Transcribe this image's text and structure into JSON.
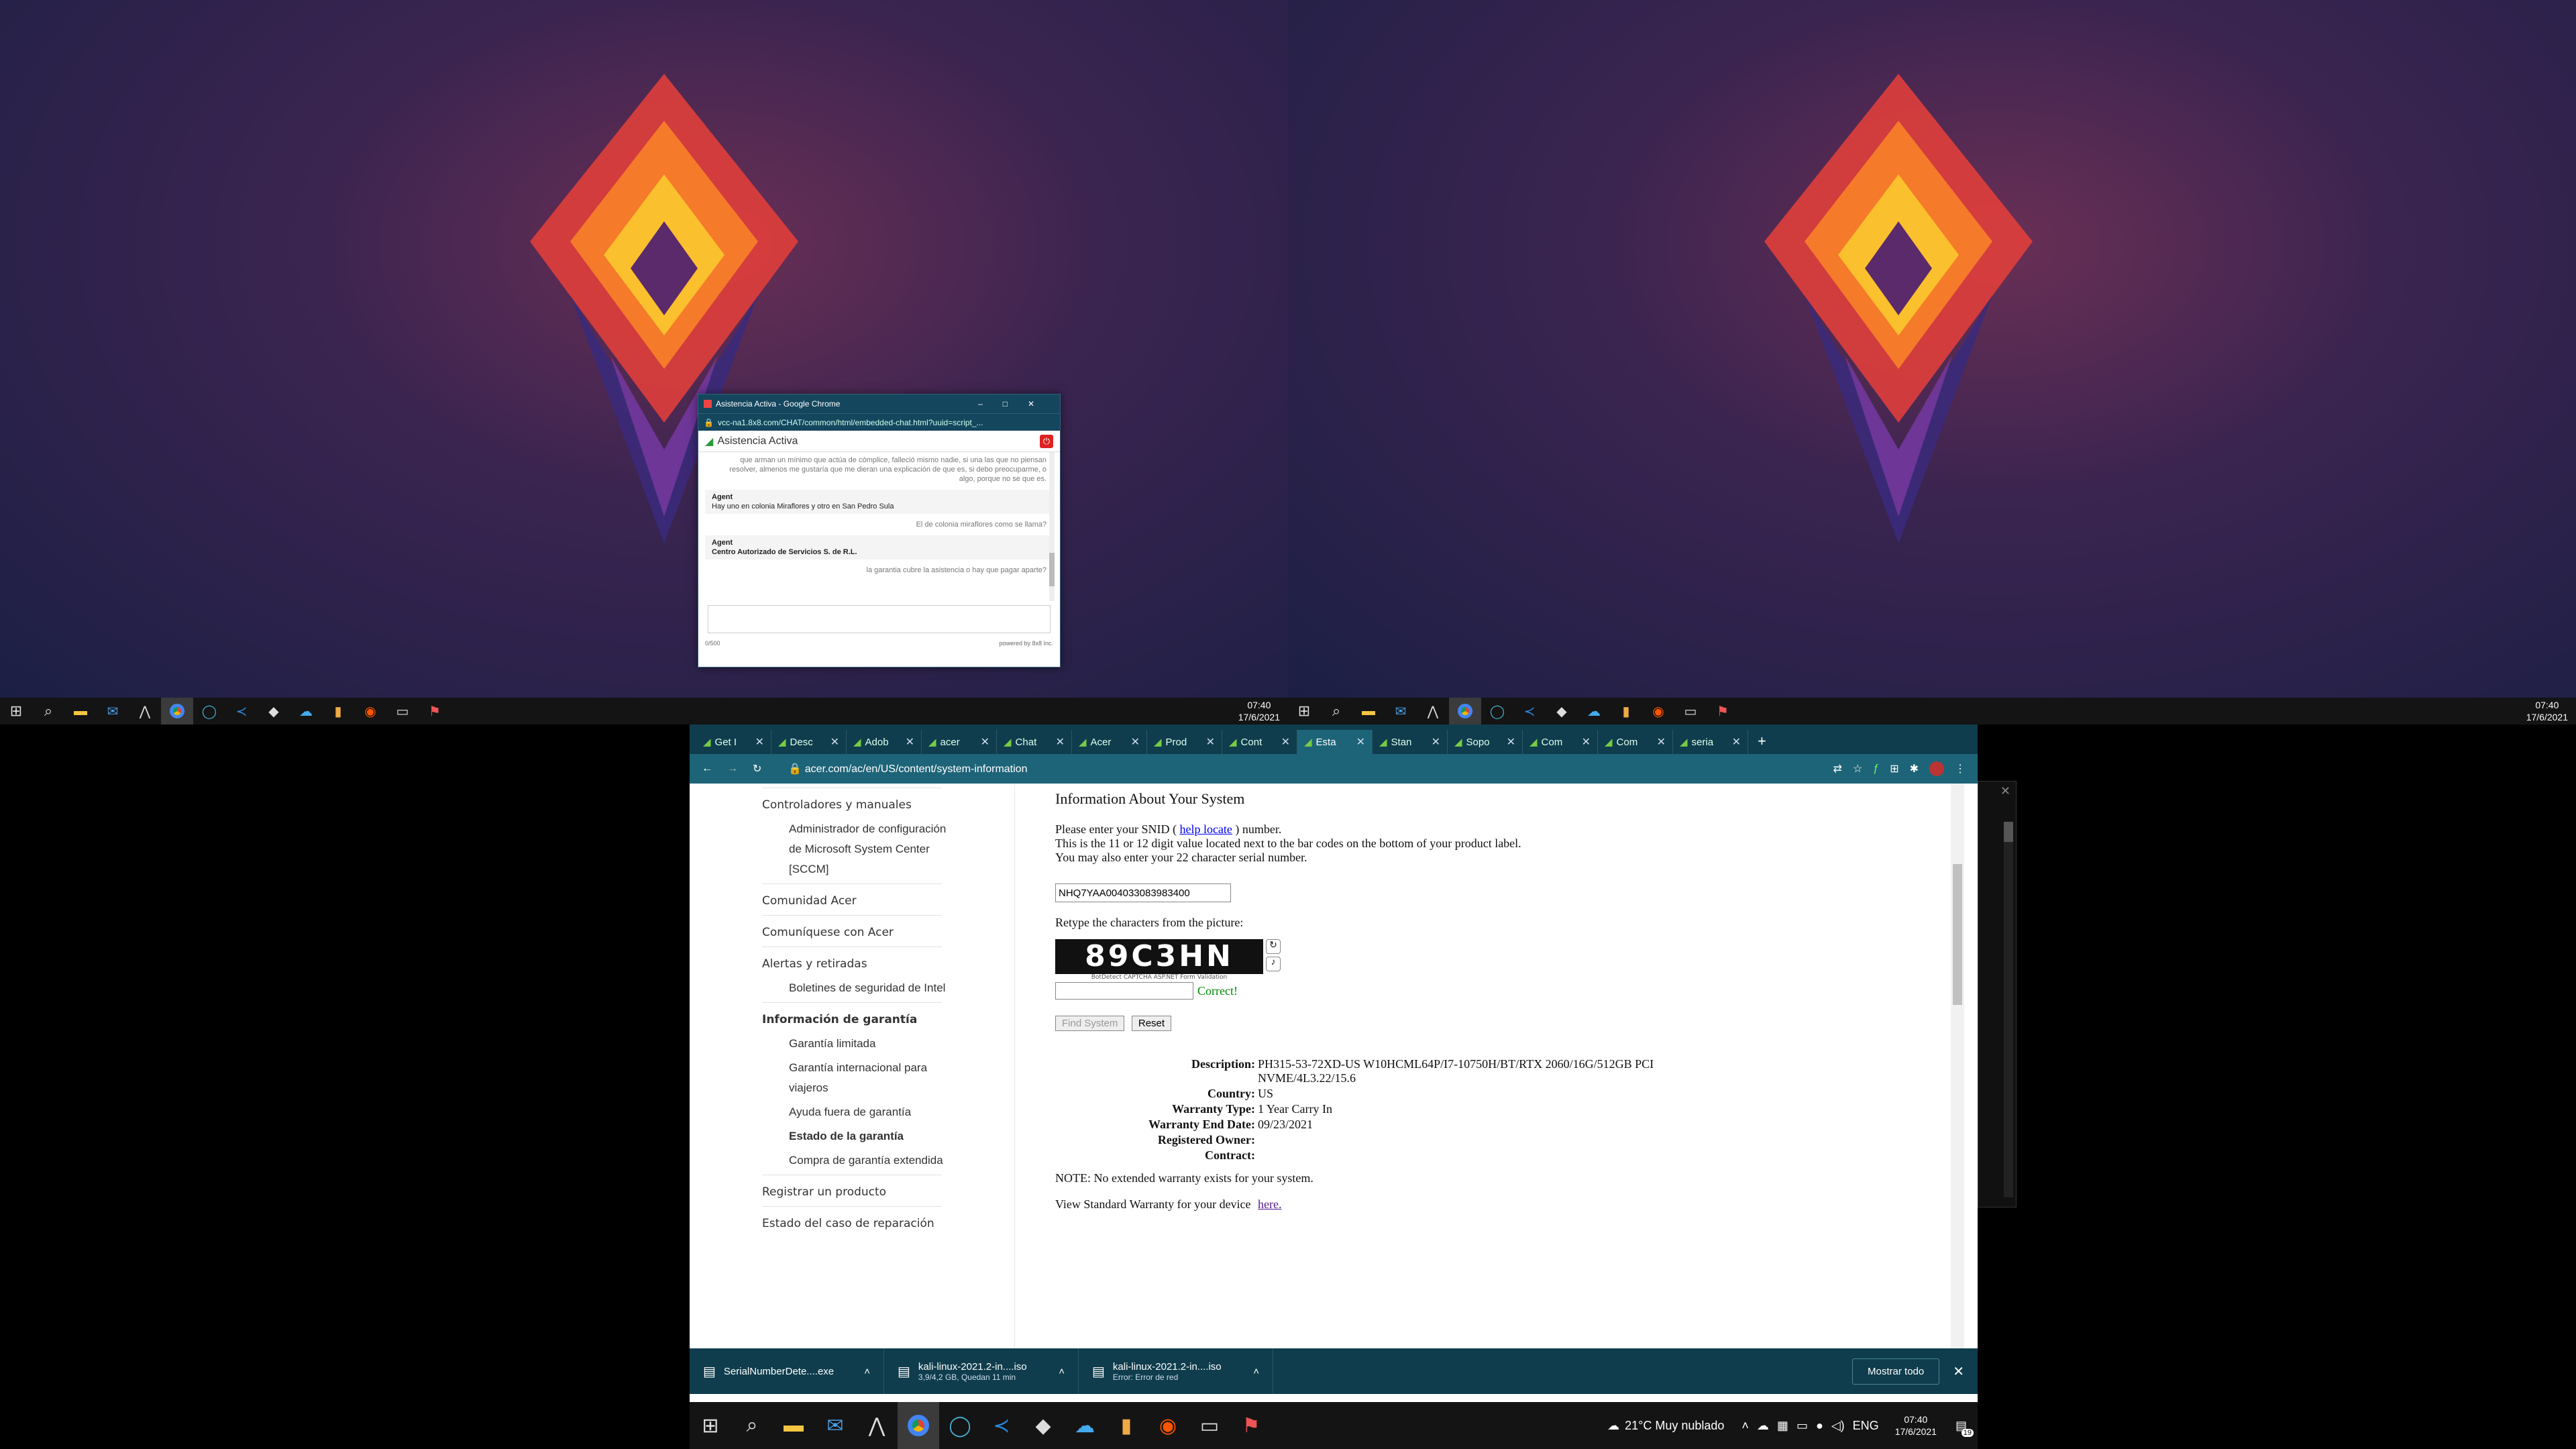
{
  "chat": {
    "window_title": "Asistencia Activa - Google Chrome",
    "url": "vcc-na1.8x8.com/CHAT/common/html/embedded-chat.html?uuid=script_...",
    "header": "Asistencia Activa",
    "messages": [
      {
        "from": "user",
        "text": "que arman un mínimo que actúa de cómplice, falleció mismo nadie, si una las que no piensan resolver, almenos me gustaría que me dieran una explicación de que es, si debo preocuparme, o algo, porque no se que es."
      },
      {
        "from": "agent",
        "name": "Agent",
        "text": "Hay uno en colonia Miraflores y otro en San Pedro Sula"
      },
      {
        "from": "user",
        "text": "El de colonia miraflores como se llama?"
      },
      {
        "from": "agent",
        "name": "Agent",
        "text": "Centro Autorizado de Servicios S. de R.L."
      },
      {
        "from": "user",
        "text": "la garantia cubre la asistencia o hay que pagar aparte?"
      }
    ],
    "counter": "0/500",
    "powered": "powered by 8x8 Inc."
  },
  "taskbar_top": {
    "time": "07:40",
    "date": "17/6/2021"
  },
  "browser": {
    "tabs": [
      "Get I",
      "Desc",
      "Adob",
      "acer",
      "Chat",
      "Acer",
      "Prod",
      "Cont",
      "Esta",
      "Stan",
      "Sopo",
      "Com",
      "Com",
      "seria"
    ],
    "active_tab": 8,
    "url": "acer.com/ac/en/US/content/system-information",
    "sidebar": {
      "items": [
        {
          "text": "Controladores y manuales",
          "type": "item"
        },
        {
          "text": "Administrador de configuración de Microsoft System Center [SCCM]",
          "type": "sub"
        },
        {
          "text": "Comunidad Acer",
          "type": "item"
        },
        {
          "text": "Comuníquese con Acer",
          "type": "item"
        },
        {
          "text": "Alertas y retiradas",
          "type": "item"
        },
        {
          "text": "Boletines de seguridad de Intel",
          "type": "sub"
        },
        {
          "text": "Información de garantía",
          "type": "item-bold"
        },
        {
          "text": "Garantía limitada",
          "type": "sub"
        },
        {
          "text": "Garantía internacional para viajeros",
          "type": "sub"
        },
        {
          "text": "Ayuda fuera de garantía",
          "type": "sub"
        },
        {
          "text": "Estado de la garantía",
          "type": "sub-bold"
        },
        {
          "text": "Compra de garantía extendida",
          "type": "sub"
        },
        {
          "text": "Registrar un producto",
          "type": "item"
        },
        {
          "text": "Estado del caso de reparación",
          "type": "item"
        }
      ]
    },
    "content": {
      "heading": "Information About Your System",
      "snid_prompt_1": "Please enter your SNID (",
      "snid_link": "help locate",
      "snid_prompt_2": ") number.",
      "snid_line2": "This is the 11 or 12 digit value located next to the bar codes on the bottom of your product label.",
      "snid_line3": "You may also enter your 22 character serial number.",
      "serial_value": "NHQ7YAA004033083983400",
      "captcha_prompt": "Retype the characters from the picture:",
      "captcha_text": "89C3HN",
      "captcha_caption": "BotDetect CAPTCHA ASP.NET Form Validation",
      "correct": "Correct!",
      "find_button": "Find System",
      "reset_button": "Reset",
      "details": [
        {
          "k": "Description:",
          "v": "PH315-53-72XD-US W10HCML64P/I7-10750H/BT/RTX 2060/16G/512GB PCI NVME/4L3.22/15.6"
        },
        {
          "k": "Country:",
          "v": "US"
        },
        {
          "k": "Warranty Type:",
          "v": "1 Year Carry In"
        },
        {
          "k": "Warranty End Date:",
          "v": "09/23/2021"
        },
        {
          "k": "Registered Owner:",
          "v": ""
        },
        {
          "k": "Contract:",
          "v": ""
        }
      ],
      "note": "NOTE: No extended warranty exists for your system.",
      "view_text": "View Standard Warranty for your device",
      "view_link": "here."
    },
    "downloads": [
      {
        "name": "SerialNumberDete....exe",
        "status": ""
      },
      {
        "name": "kali-linux-2021.2-in....iso",
        "status": "3,9/4,2 GB, Quedan 11 min"
      },
      {
        "name": "kali-linux-2021.2-in....iso",
        "status": "Error: Error de red"
      }
    ],
    "show_all": "Mostrar todo"
  },
  "taskbar_bottom": {
    "weather": "21°C  Muy nublado",
    "lang": "ENG",
    "time": "07:40",
    "date": "17/6/2021",
    "badge": "19"
  }
}
